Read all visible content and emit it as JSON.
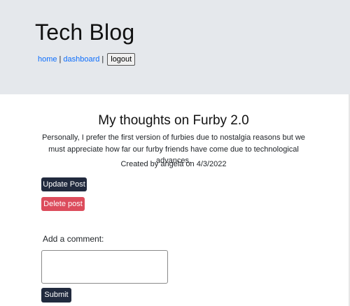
{
  "header": {
    "site_title": "Tech Blog",
    "nav": {
      "home": "home",
      "separator": "|",
      "dashboard": "dashboard",
      "logout": "logout"
    }
  },
  "post": {
    "title": "My thoughts on Furby 2.0",
    "body": "Personally, I prefer the first version of furbies due to nostalgia reasons but we must appreciate how far our furby friends have come due to technological advances.",
    "meta": "Created by angela on 4/3/2022"
  },
  "actions": {
    "update_label": "Update Post",
    "delete_label": "Delete post"
  },
  "comment": {
    "label": "Add a comment:",
    "value": "",
    "submit_label": "Submit"
  },
  "colors": {
    "header_bg": "#e5e8ec",
    "link": "#0d6efd",
    "dark_button": "#212a3e",
    "danger_button": "#dc4c5c"
  }
}
